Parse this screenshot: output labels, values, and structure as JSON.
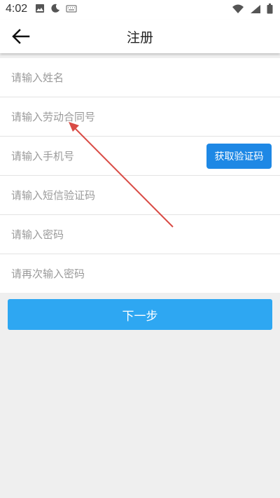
{
  "status": {
    "time": "4:02",
    "icons": [
      "image-icon",
      "moon-icon",
      "keyboard-icon",
      "wifi-icon",
      "signal-icon",
      "battery-icon"
    ]
  },
  "appbar": {
    "title": "注册"
  },
  "form": {
    "fields": [
      {
        "placeholder": "请输入姓名",
        "value": ""
      },
      {
        "placeholder": "请输入劳动合同号",
        "value": ""
      },
      {
        "placeholder": "请输入手机号",
        "value": ""
      },
      {
        "placeholder": "请输入短信验证码",
        "value": ""
      },
      {
        "placeholder": "请输入密码",
        "value": ""
      },
      {
        "placeholder": "请再次输入密码",
        "value": ""
      }
    ],
    "get_code_label": "获取验证码",
    "next_label": "下一步"
  },
  "colors": {
    "accent": "#2ea7f2",
    "code_button": "#1e88e5",
    "annotation_arrow": "#d94b45"
  }
}
